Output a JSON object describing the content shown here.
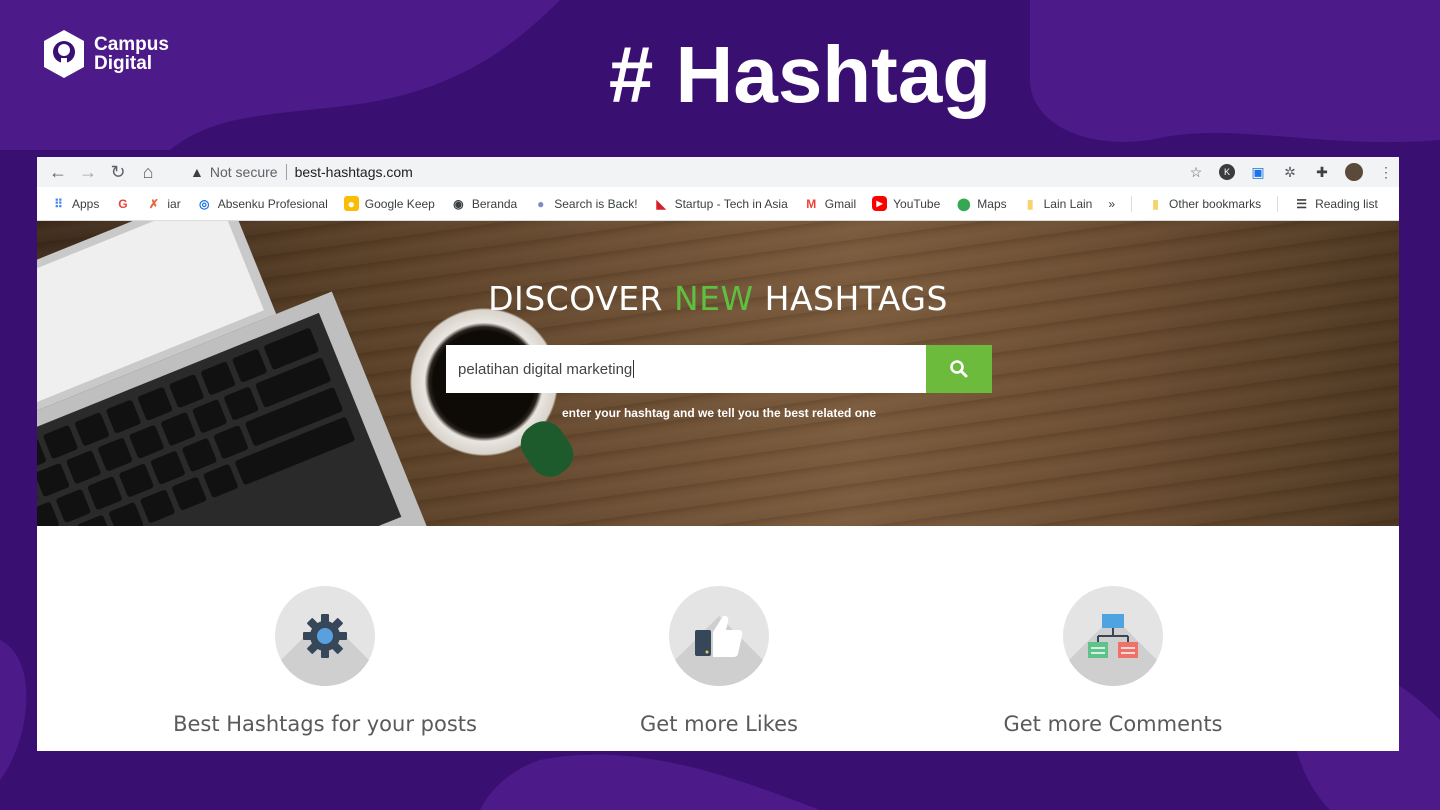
{
  "slide": {
    "logo_line1": "Campus",
    "logo_line2": "Digital",
    "title": "# Hashtag"
  },
  "browser": {
    "omnibox": {
      "security_label": "Not secure",
      "url": "best-hashtags.com"
    },
    "bookmarks": [
      {
        "label": "Apps",
        "icon": "apps-grid-icon"
      },
      {
        "label": "",
        "icon": "google-icon"
      },
      {
        "label": "iar",
        "icon": "iar-icon"
      },
      {
        "label": "Absenku Profesional",
        "icon": "fingerprint-icon"
      },
      {
        "label": "Google Keep",
        "icon": "keep-icon"
      },
      {
        "label": "Beranda",
        "icon": "globe-icon"
      },
      {
        "label": "Search is Back!",
        "icon": "search-back-icon"
      },
      {
        "label": "Startup - Tech in Asia",
        "icon": "techinasia-icon"
      },
      {
        "label": "Gmail",
        "icon": "gmail-icon"
      },
      {
        "label": "YouTube",
        "icon": "youtube-icon"
      },
      {
        "label": "Maps",
        "icon": "maps-pin-icon"
      },
      {
        "label": "Lain Lain",
        "icon": "folder-icon"
      },
      {
        "label": "»",
        "icon": "overflow-chevron-icon"
      },
      {
        "label": "Other bookmarks",
        "icon": "folder-icon"
      },
      {
        "label": "Reading list",
        "icon": "reading-list-icon"
      }
    ]
  },
  "page": {
    "hero": {
      "heading_part1": "DISCOVER ",
      "heading_accent": "NEW",
      "heading_part2": " HASHTAGS",
      "search_value": "pelatihan digital marketing",
      "subtitle": "enter your hashtag and we tell you the best related one"
    },
    "features": [
      {
        "label": "Best Hashtags for your posts",
        "icon": "gear-icon"
      },
      {
        "label": "Get more Likes",
        "icon": "thumbs-up-icon"
      },
      {
        "label": "Get more Comments",
        "icon": "sitemap-icon"
      }
    ]
  },
  "colors": {
    "slide_bg": "#3a0f72",
    "accent_green": "#6dbb3c",
    "heading_green": "#5fbf3f"
  }
}
